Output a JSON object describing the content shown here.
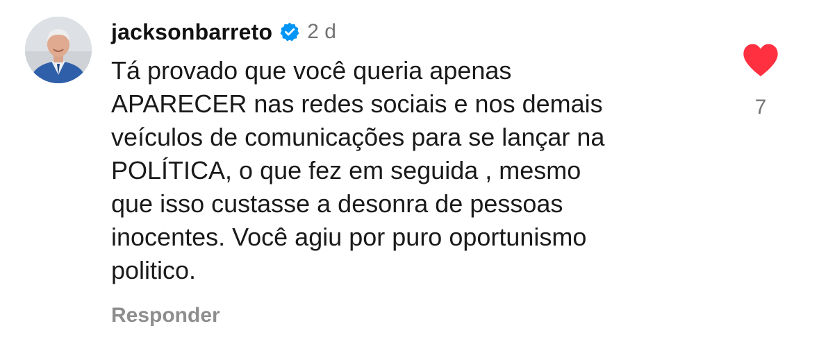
{
  "comment": {
    "username": "jacksonbarreto",
    "verified": true,
    "verified_icon": "verified-badge-icon",
    "time": "2 d",
    "text_lines": [
      "Tá provado que você queria apenas",
      "APARECER nas redes sociais e nos demais",
      "veículos de comunicações para se lançar na",
      "POLÍTICA, o que fez em seguida , mesmo",
      "que isso custasse a desonra de pessoas",
      "inocentes. Você agiu por puro oportunismo",
      "politico."
    ],
    "reply_label": "Responder",
    "like_count": "7",
    "liked": true,
    "like_icon": "heart-icon"
  },
  "colors": {
    "heart": "#ff3040",
    "verified": "#0095f6",
    "muted_text": "#737373",
    "reply_text": "#8e8e8e"
  }
}
